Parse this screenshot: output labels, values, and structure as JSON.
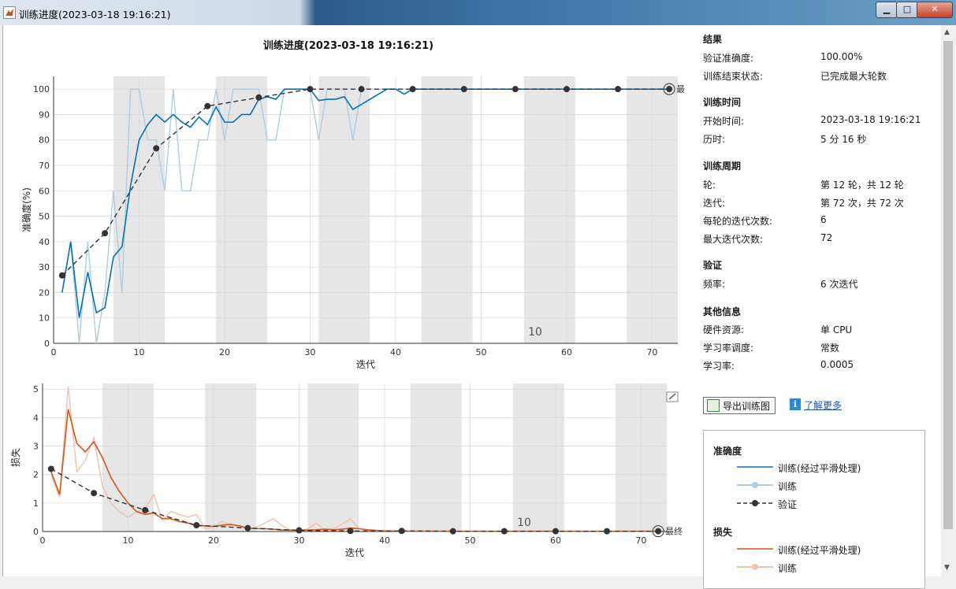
{
  "window": {
    "title": "训练进度(2023-03-18 19:16:21)",
    "min_glyph": "▁",
    "max_glyph": "□",
    "close_glyph": "✕"
  },
  "figure_title": "训练进度(2023-03-18 19:16:21)",
  "badge_epoch": "10",
  "final_label": "最终",
  "chart_data": [
    {
      "type": "line",
      "xlabel": "迭代",
      "ylabel": "准确度(%)",
      "xlim": [
        0,
        73
      ],
      "ylim": [
        0,
        105
      ],
      "xticks": [
        "0",
        "10",
        "20",
        "30",
        "40",
        "50",
        "60",
        "70"
      ],
      "yticks": [
        "0",
        "10",
        "20",
        "30",
        "40",
        "50",
        "60",
        "70",
        "80",
        "90",
        "100"
      ],
      "grid": true,
      "epoch_shading": "alternate epochs of 6 iterations shaded gray",
      "series": [
        {
          "name": "训练(经过平滑处理)",
          "color": "#0072BD",
          "x": [
            1,
            2,
            3,
            4,
            5,
            6,
            7,
            8,
            9,
            10,
            11,
            12,
            13,
            14,
            15,
            16,
            17,
            18,
            19,
            20,
            21,
            22,
            23,
            24,
            25,
            26,
            27,
            28,
            29,
            30,
            31,
            32,
            33,
            34,
            35,
            36,
            37,
            38,
            39,
            40,
            41,
            42,
            43,
            44,
            45,
            46,
            47,
            48,
            49,
            50,
            51,
            52,
            53,
            54,
            55,
            56,
            57,
            58,
            59,
            60,
            61,
            62,
            63,
            64,
            65,
            66,
            67,
            68,
            69,
            70,
            71,
            72
          ],
          "y": [
            20,
            40,
            10,
            28,
            12,
            14,
            34,
            38,
            62,
            80,
            86,
            90,
            87,
            90,
            87,
            85,
            89,
            86,
            93,
            87,
            87,
            90,
            90,
            96,
            97,
            96,
            100,
            100,
            100,
            100,
            95.5,
            96,
            96,
            97,
            92,
            94,
            96,
            98,
            100,
            100,
            98,
            100,
            100,
            100,
            100,
            100,
            100,
            100,
            100,
            100,
            100,
            100,
            100,
            100,
            100,
            100,
            100,
            100,
            100,
            100,
            100,
            100,
            100,
            100,
            100,
            100,
            100,
            100,
            100,
            100,
            100,
            100
          ]
        },
        {
          "name": "训练",
          "color": "#aecde3",
          "x": [
            1,
            2,
            3,
            4,
            5,
            6,
            7,
            8,
            9,
            10,
            11,
            12,
            13,
            14,
            15,
            16,
            17,
            18,
            19,
            20,
            21,
            22,
            23,
            24,
            25,
            26,
            27,
            28,
            29,
            30,
            31,
            32,
            33,
            34,
            35,
            36,
            37,
            38,
            39,
            40,
            41,
            42,
            43,
            44,
            45,
            46,
            47,
            48,
            49,
            50,
            51,
            52,
            53,
            54,
            55,
            56,
            57,
            58,
            59,
            60,
            61,
            62,
            63,
            64,
            65,
            66,
            67,
            68,
            69,
            70,
            71,
            72
          ],
          "y": [
            20,
            40,
            0,
            40,
            0,
            20,
            60,
            20,
            100,
            100,
            80,
            80,
            60,
            100,
            60,
            60,
            80,
            80,
            100,
            80,
            100,
            100,
            100,
            100,
            80,
            80,
            100,
            100,
            100,
            100,
            80,
            100,
            100,
            100,
            80,
            100,
            100,
            100,
            100,
            100,
            100,
            100,
            100,
            100,
            100,
            100,
            100,
            100,
            100,
            100,
            100,
            100,
            100,
            100,
            100,
            100,
            100,
            100,
            100,
            100,
            100,
            100,
            100,
            100,
            100,
            100,
            100,
            100,
            100,
            100,
            100,
            100
          ]
        },
        {
          "name": "验证",
          "color": "#333333",
          "x": [
            1,
            6,
            12,
            18,
            24,
            30,
            36,
            42,
            48,
            54,
            60,
            66,
            72
          ],
          "y": [
            26.7,
            43.3,
            76.7,
            93.3,
            96.7,
            100,
            100,
            100,
            100,
            100,
            100,
            100,
            100
          ]
        }
      ]
    },
    {
      "type": "line",
      "xlabel": "迭代",
      "ylabel": "损失",
      "xlim": [
        0,
        73
      ],
      "ylim": [
        0,
        5.2
      ],
      "xticks": [
        "0",
        "10",
        "20",
        "30",
        "40",
        "50",
        "60",
        "70"
      ],
      "yticks": [
        "0",
        "1",
        "2",
        "3",
        "4",
        "5"
      ],
      "grid": true,
      "series": [
        {
          "name": "训练(经过平滑处理)",
          "color": "#D95319",
          "x": [
            1,
            2,
            3,
            4,
            5,
            6,
            7,
            8,
            9,
            10,
            11,
            12,
            13,
            14,
            15,
            16,
            17,
            18,
            19,
            20,
            21,
            22,
            23,
            24,
            25,
            26,
            27,
            28,
            29,
            30,
            31,
            32,
            33,
            34,
            35,
            36,
            37,
            38,
            39,
            40,
            41,
            42,
            43,
            44,
            45,
            46,
            47,
            48,
            49,
            50,
            51,
            52,
            53,
            54,
            55,
            56,
            57,
            58,
            59,
            60,
            61,
            62,
            63,
            64,
            65,
            66,
            67,
            68,
            69,
            70,
            71,
            72
          ],
          "y": [
            2.1,
            1.3,
            4.3,
            3.1,
            2.8,
            3.15,
            2.6,
            1.9,
            1.4,
            1.0,
            0.7,
            0.6,
            0.65,
            0.45,
            0.45,
            0.35,
            0.3,
            0.2,
            0.2,
            0.18,
            0.22,
            0.25,
            0.2,
            0.12,
            0.1,
            0.1,
            0.08,
            0.05,
            0.05,
            0.05,
            0.05,
            0.06,
            0.08,
            0.06,
            0.08,
            0.12,
            0.1,
            0.06,
            0.04,
            0.02,
            0.02,
            0.02,
            0.01,
            0.01,
            0.01,
            0.01,
            0.01,
            0.01,
            0.01,
            0.01,
            0.01,
            0.01,
            0.01,
            0.01,
            0.01,
            0.01,
            0.01,
            0.01,
            0.01,
            0.01,
            0.01,
            0.01,
            0.01,
            0.01,
            0.01,
            0.01,
            0.01,
            0.01,
            0.01,
            0.01,
            0.01,
            0.01
          ]
        },
        {
          "name": "训练",
          "color": "#efc3ab",
          "x": [
            1,
            2,
            3,
            4,
            5,
            6,
            7,
            8,
            9,
            10,
            11,
            12,
            13,
            14,
            15,
            16,
            17,
            18,
            19,
            20,
            21,
            22,
            23,
            24,
            25,
            26,
            27,
            28,
            29,
            30,
            31,
            32,
            33,
            34,
            35,
            36,
            37,
            38,
            39,
            40,
            41,
            42,
            43,
            44,
            45,
            46,
            47,
            48,
            49,
            50,
            51,
            52,
            53,
            54,
            55,
            56,
            57,
            58,
            59,
            60,
            61,
            62,
            63,
            64,
            65,
            66,
            67,
            68,
            69,
            70,
            71,
            72
          ],
          "y": [
            2.0,
            1.2,
            5.1,
            2.1,
            2.5,
            3.3,
            1.6,
            1.0,
            0.7,
            0.5,
            0.7,
            0.8,
            1.3,
            0.4,
            0.7,
            0.6,
            0.5,
            0.6,
            0.1,
            0.15,
            0.35,
            0.25,
            0.15,
            0.08,
            0.15,
            0.3,
            0.45,
            0.2,
            0.05,
            0.05,
            0.08,
            0.3,
            0.05,
            0.1,
            0.25,
            0.45,
            0.1,
            0.05,
            0.02,
            0.02,
            0.02,
            0.01,
            0.01,
            0.01,
            0.01,
            0.01,
            0.01,
            0.01,
            0.01,
            0.01,
            0.01,
            0.01,
            0.01,
            0.01,
            0.01,
            0.01,
            0.01,
            0.01,
            0.01,
            0.01,
            0.01,
            0.01,
            0.01,
            0.01,
            0.01,
            0.01,
            0.01,
            0.01,
            0.01,
            0.01,
            0.01,
            0.01
          ]
        },
        {
          "name": "验证",
          "color": "#333333",
          "x": [
            1,
            6,
            12,
            18,
            24,
            30,
            36,
            42,
            48,
            54,
            60,
            66,
            72
          ],
          "y": [
            2.2,
            1.35,
            0.75,
            0.22,
            0.12,
            0.04,
            0.02,
            0.02,
            0.01,
            0.01,
            0.01,
            0.01,
            0.01
          ]
        }
      ]
    }
  ],
  "results": {
    "h_results": "结果",
    "val_acc_label": "验证准确度:",
    "val_acc_value": "100.00%",
    "end_state_label": "训练结束状态:",
    "end_state_value": "已完成最大轮数",
    "h_time": "训练时间",
    "start_label": "开始时间:",
    "start_value": "2023-03-18 19:16:21",
    "elapsed_label": "历时:",
    "elapsed_value": "5 分 16 秒",
    "h_cycle": "训练周期",
    "epoch_label": "轮:",
    "epoch_value": "第 12 轮，共 12 轮",
    "iter_label": "迭代:",
    "iter_value": "第 72 次，共 72 次",
    "iter_per_epoch_label": "每轮的迭代次数:",
    "iter_per_epoch_value": "6",
    "max_iter_label": "最大迭代次数:",
    "max_iter_value": "72",
    "h_val": "验证",
    "freq_label": "频率:",
    "freq_value": "6 次迭代",
    "h_other": "其他信息",
    "hw_label": "硬件资源:",
    "hw_value": "单 CPU",
    "lr_sched_label": "学习率调度:",
    "lr_sched_value": "常数",
    "lr_label": "学习率:",
    "lr_value": "0.0005"
  },
  "actions": {
    "export_label": "导出训练图",
    "learn_more": "了解更多",
    "info_glyph": "i"
  },
  "legend": {
    "accuracy_heading": "准确度",
    "acc_smoothed": "训练(经过平滑处理)",
    "acc_train": "训练",
    "acc_val": "验证",
    "loss_heading": "损失",
    "loss_smoothed": "训练(经过平滑处理)",
    "loss_train": "训练"
  }
}
